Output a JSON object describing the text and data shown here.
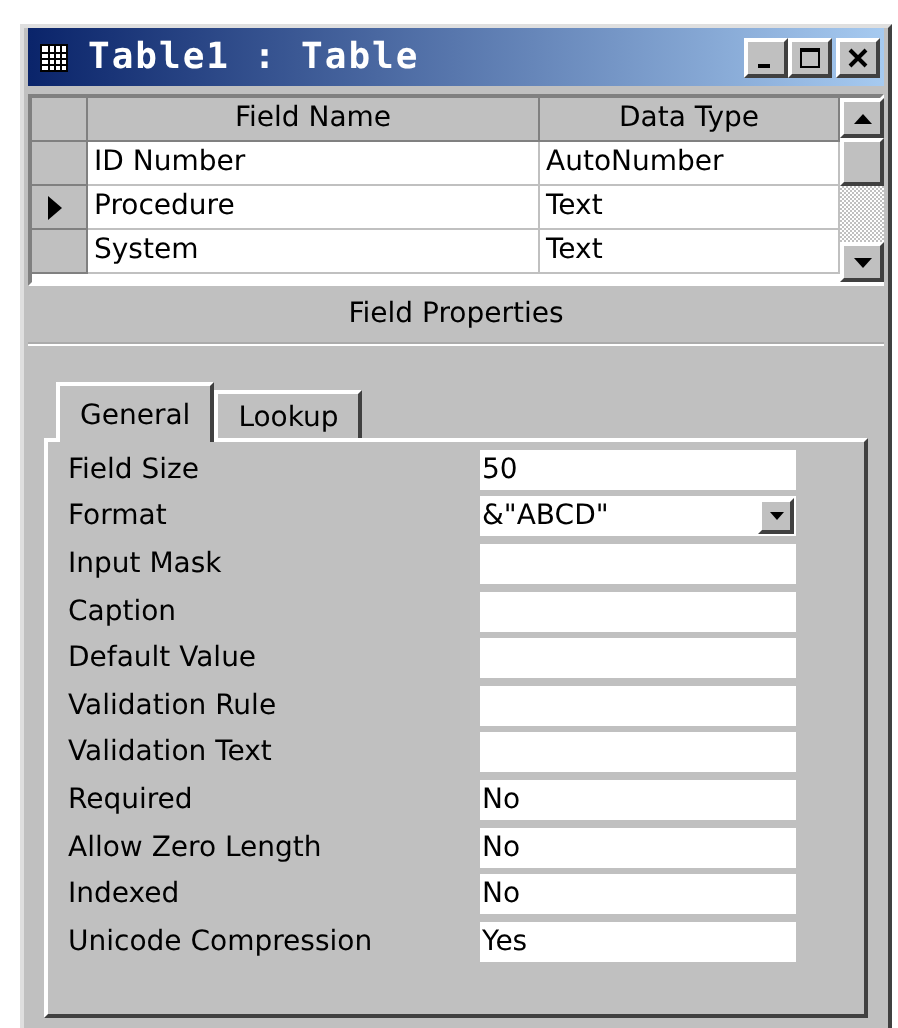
{
  "window": {
    "title": "Table1 : Table"
  },
  "grid": {
    "columns": [
      "Field Name",
      "Data Type"
    ],
    "rows": [
      {
        "field_name": "ID Number",
        "data_type": "AutoNumber",
        "selected": false
      },
      {
        "field_name": "Procedure",
        "data_type": "Text",
        "selected": true
      },
      {
        "field_name": "System",
        "data_type": "Text",
        "selected": false
      }
    ]
  },
  "field_properties": {
    "heading": "Field Properties",
    "tabs": [
      {
        "label": "General",
        "selected": true
      },
      {
        "label": "Lookup",
        "selected": false
      }
    ],
    "properties": [
      {
        "label": "Field Size",
        "value": "50",
        "kind": "text"
      },
      {
        "label": "Format",
        "value": "&\"ABCD\"",
        "kind": "dropdown"
      },
      {
        "label": "Input Mask",
        "kind": "text"
      },
      {
        "label": "Caption",
        "kind": "text"
      },
      {
        "label": "Default Value",
        "kind": "text"
      },
      {
        "label": "Validation Rule",
        "kind": "text"
      },
      {
        "label": "Validation Text",
        "kind": "text"
      },
      {
        "label": "Required",
        "value": "No",
        "kind": "text"
      },
      {
        "label": "Allow Zero Length",
        "value": "No",
        "kind": "text"
      },
      {
        "label": "Indexed",
        "value": "No",
        "kind": "text"
      },
      {
        "label": "Unicode Compression",
        "value": "Yes",
        "kind": "text"
      }
    ]
  }
}
